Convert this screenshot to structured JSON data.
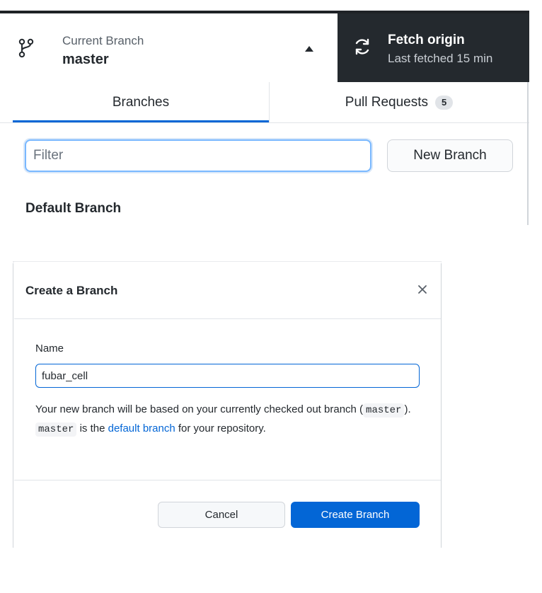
{
  "toolbar": {
    "current_branch_caption": "Current Branch",
    "current_branch_name": "master",
    "fetch_title": "Fetch origin",
    "fetch_subtitle": "Last fetched 15 min"
  },
  "tabs": {
    "branches_label": "Branches",
    "pull_requests_label": "Pull Requests",
    "pull_requests_count": "5"
  },
  "branches_panel": {
    "filter_placeholder": "Filter",
    "new_branch_label": "New Branch",
    "default_branch_header": "Default Branch"
  },
  "dialog": {
    "title": "Create a Branch",
    "name_label": "Name",
    "name_value": "fubar_cell",
    "desc_part1": "Your new branch will be based on your currently checked out branch (",
    "desc_code1": "master",
    "desc_part2": "). ",
    "desc_code2": "master",
    "desc_part3": " is the ",
    "desc_link": "default branch",
    "desc_part4": " for your repository.",
    "cancel_label": "Cancel",
    "create_label": "Create Branch"
  },
  "icons": {
    "branch": "git-branch-icon",
    "caret": "caret-up-icon",
    "sync": "sync-icon",
    "close": "close-icon"
  },
  "colors": {
    "accent": "#0366d6",
    "toolbar_dark": "#24292e"
  }
}
